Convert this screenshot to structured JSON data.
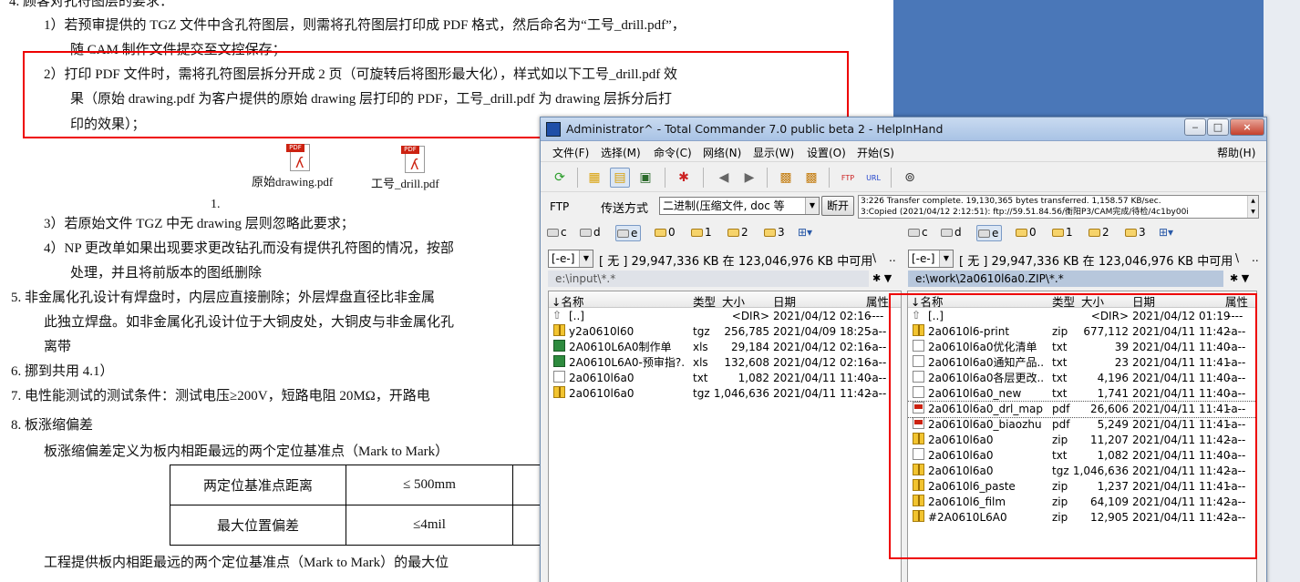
{
  "doc": {
    "line_top": "4.   顾客对孔符图层的要求：",
    "item1a": "1）若预审提供的 TGZ 文件中含孔符图层，则需将孔符图层打印成 PDF 格式，然后命名为“工号_drill.pdf”，",
    "item1b": "随 CAM 制作文件提交至文控保存；",
    "item2a": "2）打印 PDF 文件时，需将孔符图层拆分开成 2 页（可旋转后将图形最大化），样式如以下工号_drill.pdf 效",
    "item2b": "果（原始 drawing.pdf 为客户提供的原始 drawing 层打印的 PDF，工号_drill.pdf 为 drawing 层拆分后打",
    "item2c": "印的效果）；",
    "pdf1": "原始drawing.pdf",
    "pdf2": "工号_drill.pdf",
    "pdf_badge": "PDF",
    "num1": "1.",
    "item3": "3）若原始文件 TGZ 中无 drawing 层则忽略此要求；",
    "item4a": "4）NP 更改单如果出现要求更改钻孔而没有提供孔符图的情况，按部",
    "item4b": "处理，并且将前版本的图纸删除",
    "sec5a": "5.    非金属化孔设计有焊盘时，内层应直接删除；外层焊盘直径比非金属",
    "sec5b": "此独立焊盘。如非金属化孔设计位于大铜皮处，大铜皮与非金属化孔",
    "sec5c": "离带",
    "sec6": "6.    挪到共用 4.1）",
    "sec7": "7.    电性能测试的测试条件：测试电压≥200V，短路电阻 20MΩ，开路电",
    "sec8": "8.    板涨缩偏差",
    "sec8a": "板涨缩偏差定义为板内相距最远的两个定位基准点（Mark  to  Mark）",
    "table": [
      [
        "两定位基准点距离",
        "≤  500mm"
      ],
      [
        "最大位置偏差",
        "≤4mil"
      ]
    ],
    "last": "工程提供板内相距最远的两个定位基准点（Mark  to  Mark）的最大位"
  },
  "tc": {
    "title": "Administrator^ - Total Commander 7.0 public beta 2 - HelpInHand",
    "menu": [
      "文件(F)",
      "选择(M)",
      "命令(C)",
      "网络(N)",
      "显示(W)",
      "设置(O)",
      "开始(S)"
    ],
    "help": "帮助(H)",
    "ftp_label": "FTP",
    "transfer_label": "传送方式",
    "transfer_value": "二进制(压缩文件, doc 等",
    "disconnect": "断开",
    "log": [
      "3:226 Transfer complete. 19,130,365 bytes transferred. 1,158.57 KB/sec.",
      "3:Copied (2021/04/12 2:12:51): ftp://59.51.84.56/衡阳P3/CAM完成/待检/4c1by00i"
    ],
    "drives": [
      "c",
      "d",
      "e",
      "0",
      "1",
      "2",
      "3"
    ],
    "left": {
      "drive": "[-e-]",
      "freespace": "[ 无 ]  29,947,336 KB 在 123,046,976 KB 中可用",
      "path": "e:\\input\\*.*",
      "cols": [
        "↓名称",
        "类型",
        "大小",
        "日期",
        "属性"
      ],
      "files": [
        {
          "icon": "up",
          "name": "[..]",
          "ext": "",
          "size": "<DIR>",
          "date": "2021/04/12 02:16",
          "attr": "----"
        },
        {
          "icon": "arch",
          "name": "y2a0610l60",
          "ext": "tgz",
          "size": "256,785",
          "date": "2021/04/09 18:25",
          "attr": "-a--"
        },
        {
          "icon": "xls",
          "name": "2A0610L6A0制作单",
          "ext": "xls",
          "size": "29,184",
          "date": "2021/04/12 02:16",
          "attr": "-a--"
        },
        {
          "icon": "xls",
          "name": "2A0610L6A0-预审指?.",
          "ext": "xls",
          "size": "132,608",
          "date": "2021/04/12 02:16",
          "attr": "-a--"
        },
        {
          "icon": "txt",
          "name": "2a0610l6a0",
          "ext": "txt",
          "size": "1,082",
          "date": "2021/04/11 11:40",
          "attr": "-a--"
        },
        {
          "icon": "arch",
          "name": "2a0610l6a0",
          "ext": "tgz",
          "size": "1,046,636",
          "date": "2021/04/11 11:42",
          "attr": "-a--"
        }
      ]
    },
    "right": {
      "drive": "[-e-]",
      "freespace": "[ 无 ]  29,947,336 KB 在 123,046,976 KB 中可用",
      "path": "e:\\work\\2a0610l6a0.ZIP\\*.*",
      "cols": [
        "↓名称",
        "类型",
        "大小",
        "日期",
        "属性"
      ],
      "files": [
        {
          "icon": "up",
          "name": "[..]",
          "ext": "",
          "size": "<DIR>",
          "date": "2021/04/12 01:19",
          "attr": "----"
        },
        {
          "icon": "arch",
          "name": "2a0610l6-print",
          "ext": "zip",
          "size": "677,112",
          "date": "2021/04/11 11:42",
          "attr": "-a--"
        },
        {
          "icon": "txt",
          "name": "2a0610l6a0优化清单",
          "ext": "txt",
          "size": "39",
          "date": "2021/04/11 11:40",
          "attr": "-a--"
        },
        {
          "icon": "txt",
          "name": "2a0610l6a0通知产品..",
          "ext": "txt",
          "size": "23",
          "date": "2021/04/11 11:41",
          "attr": "-a--"
        },
        {
          "icon": "txt",
          "name": "2a0610l6a0各层更改..",
          "ext": "txt",
          "size": "4,196",
          "date": "2021/04/11 11:40",
          "attr": "-a--"
        },
        {
          "icon": "txt",
          "name": "2a0610l6a0_new",
          "ext": "txt",
          "size": "1,741",
          "date": "2021/04/11 11:40",
          "attr": "-a--"
        },
        {
          "icon": "pdf",
          "name": "2a0610l6a0_drl_map",
          "ext": "pdf",
          "size": "26,606",
          "date": "2021/04/11 11:41",
          "attr": "-a--"
        },
        {
          "icon": "pdf",
          "name": "2a0610l6a0_biaozhu",
          "ext": "pdf",
          "size": "5,249",
          "date": "2021/04/11 11:41",
          "attr": "-a--"
        },
        {
          "icon": "arch",
          "name": "2a0610l6a0",
          "ext": "zip",
          "size": "11,207",
          "date": "2021/04/11 11:42",
          "attr": "-a--"
        },
        {
          "icon": "txt",
          "name": "2a0610l6a0",
          "ext": "txt",
          "size": "1,082",
          "date": "2021/04/11 11:40",
          "attr": "-a--"
        },
        {
          "icon": "arch",
          "name": "2a0610l6a0",
          "ext": "tgz",
          "size": "1,046,636",
          "date": "2021/04/11 11:42",
          "attr": "-a--"
        },
        {
          "icon": "arch",
          "name": "2a0610l6_paste",
          "ext": "zip",
          "size": "1,237",
          "date": "2021/04/11 11:41",
          "attr": "-a--"
        },
        {
          "icon": "arch",
          "name": "2a0610l6_film",
          "ext": "zip",
          "size": "64,109",
          "date": "2021/04/11 11:42",
          "attr": "-a--"
        },
        {
          "icon": "arch",
          "name": "#2A0610L6A0",
          "ext": "zip",
          "size": "12,905",
          "date": "2021/04/11 11:42",
          "attr": "-a--"
        }
      ]
    }
  }
}
